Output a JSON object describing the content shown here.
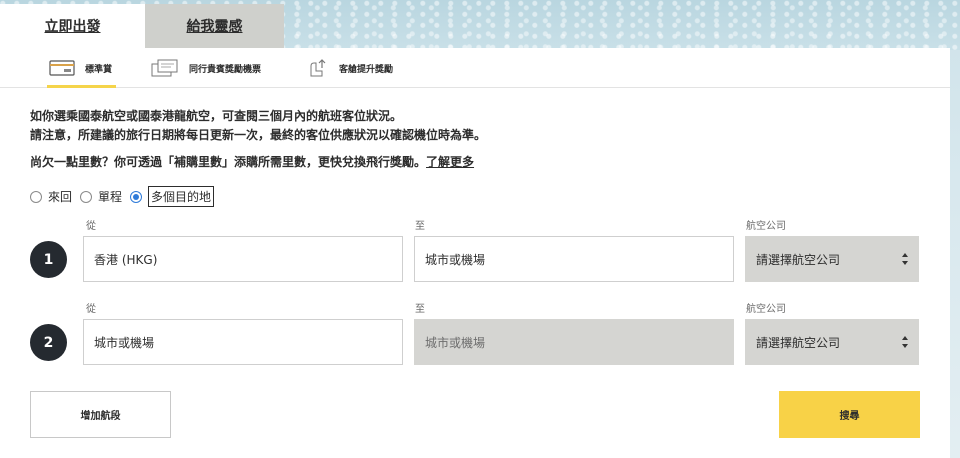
{
  "main_tabs": [
    {
      "label": "立即出發",
      "active": true
    },
    {
      "label": "給我靈感",
      "active": false
    }
  ],
  "sub_tabs": [
    {
      "label": "標準賞",
      "icon": "card-icon",
      "active": true
    },
    {
      "label": "同行貴賓獎勵機票",
      "icon": "tickets-icon",
      "active": false
    },
    {
      "label": "客艙提升獎勵",
      "icon": "seat-upgrade-icon",
      "active": false
    }
  ],
  "info": {
    "line1": "如你選乘國泰航空或國泰港龍航空，可查閱三個月內的航班客位狀況。",
    "line2": "請注意，所建議的旅行日期將每日更新一次，最終的客位供應狀況以確認機位時為準。",
    "line3": "尚欠一點里數？你可透過「補購里數」添購所需里數，更快兌換飛行獎勵。",
    "learn_more": "了解更多"
  },
  "trip_types": [
    {
      "label": "來回",
      "checked": false
    },
    {
      "label": "單程",
      "checked": false
    },
    {
      "label": "多個目的地",
      "checked": true
    }
  ],
  "segments": [
    {
      "number": "1",
      "from_label": "從",
      "from_value": "香港 (HKG)",
      "to_label": "至",
      "to_value": "城市或機場",
      "airline_label": "航空公司",
      "airline_value": "請選擇航空公司"
    },
    {
      "number": "2",
      "from_label": "從",
      "from_value": "城市或機場",
      "to_label": "至",
      "to_value": "城市或機場",
      "airline_label": "航空公司",
      "airline_value": "請選擇航空公司"
    }
  ],
  "buttons": {
    "add_segment": "增加航段",
    "search": "搜尋"
  },
  "colors": {
    "accent": "#f8d247",
    "radio_checked": "#2f7bd9",
    "badge": "#252a30"
  }
}
